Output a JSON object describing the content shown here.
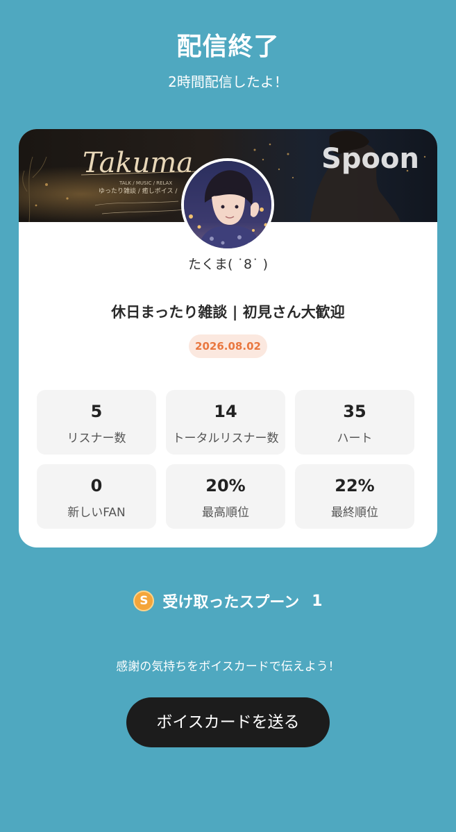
{
  "header": {
    "title": "配信終了",
    "subtitle": "2時間配信したよ！"
  },
  "card": {
    "banner": {
      "title_script": "Takuma",
      "tagline": "TALK / MUSIC / RELAX",
      "subtag": "ゆったり雑談 / 癒しボイス /",
      "brand": "Spoon"
    },
    "username": "たくま( ˙8˙ )",
    "stream_title": "休日まったり雑談 | 初見さん大歓迎",
    "date": "2026.08.02",
    "stats": [
      {
        "value": "5",
        "label": "リスナー数"
      },
      {
        "value": "14",
        "label": "トータルリスナー数"
      },
      {
        "value": "35",
        "label": "ハート"
      },
      {
        "value": "0",
        "label": "新しいFAN"
      },
      {
        "value": "20%",
        "label": "最高順位"
      },
      {
        "value": "22%",
        "label": "最終順位"
      }
    ]
  },
  "spoons": {
    "icon": "spoon-coin-icon",
    "coin_letter": "S",
    "label": "受け取ったスプーン",
    "count": "1"
  },
  "thanks_message": "感謝の気持ちをボイスカードで伝えよう！",
  "voice_card_button": "ボイスカードを送る",
  "colors": {
    "background": "#4fa8c0",
    "button": "#1c1c1c",
    "date_badge_bg": "#fbe8df",
    "date_badge_text": "#e9773f",
    "coin": "#f4a53a"
  }
}
